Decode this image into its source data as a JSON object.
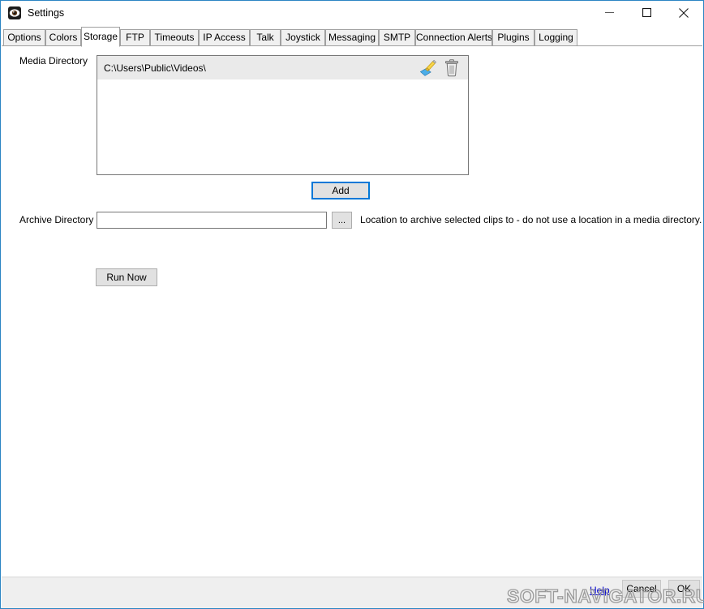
{
  "window": {
    "title": "Settings",
    "icon": "eye-icon",
    "accent_border": "#2b85c4",
    "controls": {
      "minimize": "minimize-icon",
      "maximize": "maximize-icon",
      "close": "close-icon"
    }
  },
  "tabs": [
    {
      "label": "Options",
      "selected": false
    },
    {
      "label": "Colors",
      "selected": false
    },
    {
      "label": "Storage",
      "selected": true
    },
    {
      "label": "FTP",
      "selected": false
    },
    {
      "label": "Timeouts",
      "selected": false
    },
    {
      "label": "IP Access",
      "selected": false
    },
    {
      "label": "Talk",
      "selected": false
    },
    {
      "label": "Joystick",
      "selected": false
    },
    {
      "label": "Messaging",
      "selected": false
    },
    {
      "label": "SMTP",
      "selected": false
    },
    {
      "label": "Connection Alerts",
      "selected": false
    },
    {
      "label": "Plugins",
      "selected": false
    },
    {
      "label": "Logging",
      "selected": false
    }
  ],
  "storage": {
    "media_directory": {
      "label": "Media Directory",
      "entries": [
        {
          "path": "C:\\Users\\Public\\Videos\\",
          "selected": true,
          "clean_icon": "clean-brush-icon",
          "delete_icon": "trash-icon"
        }
      ],
      "add_label": "Add",
      "add_focused": true,
      "focus_color": "#0078d7"
    },
    "archive_directory": {
      "label": "Archive Directory",
      "value": "",
      "placeholder": "",
      "browse_label": "...",
      "hint": "Location to archive selected clips to - do not use a location in a media directory."
    },
    "run_now_label": "Run Now"
  },
  "footer": {
    "help_label": "Help",
    "help_color": "#0000cc",
    "cancel_label": "Cancel",
    "ok_label": "OK"
  },
  "watermark": {
    "text": "SOFT-NAVIGATOR.RU",
    "color": "#9a9a9a"
  }
}
